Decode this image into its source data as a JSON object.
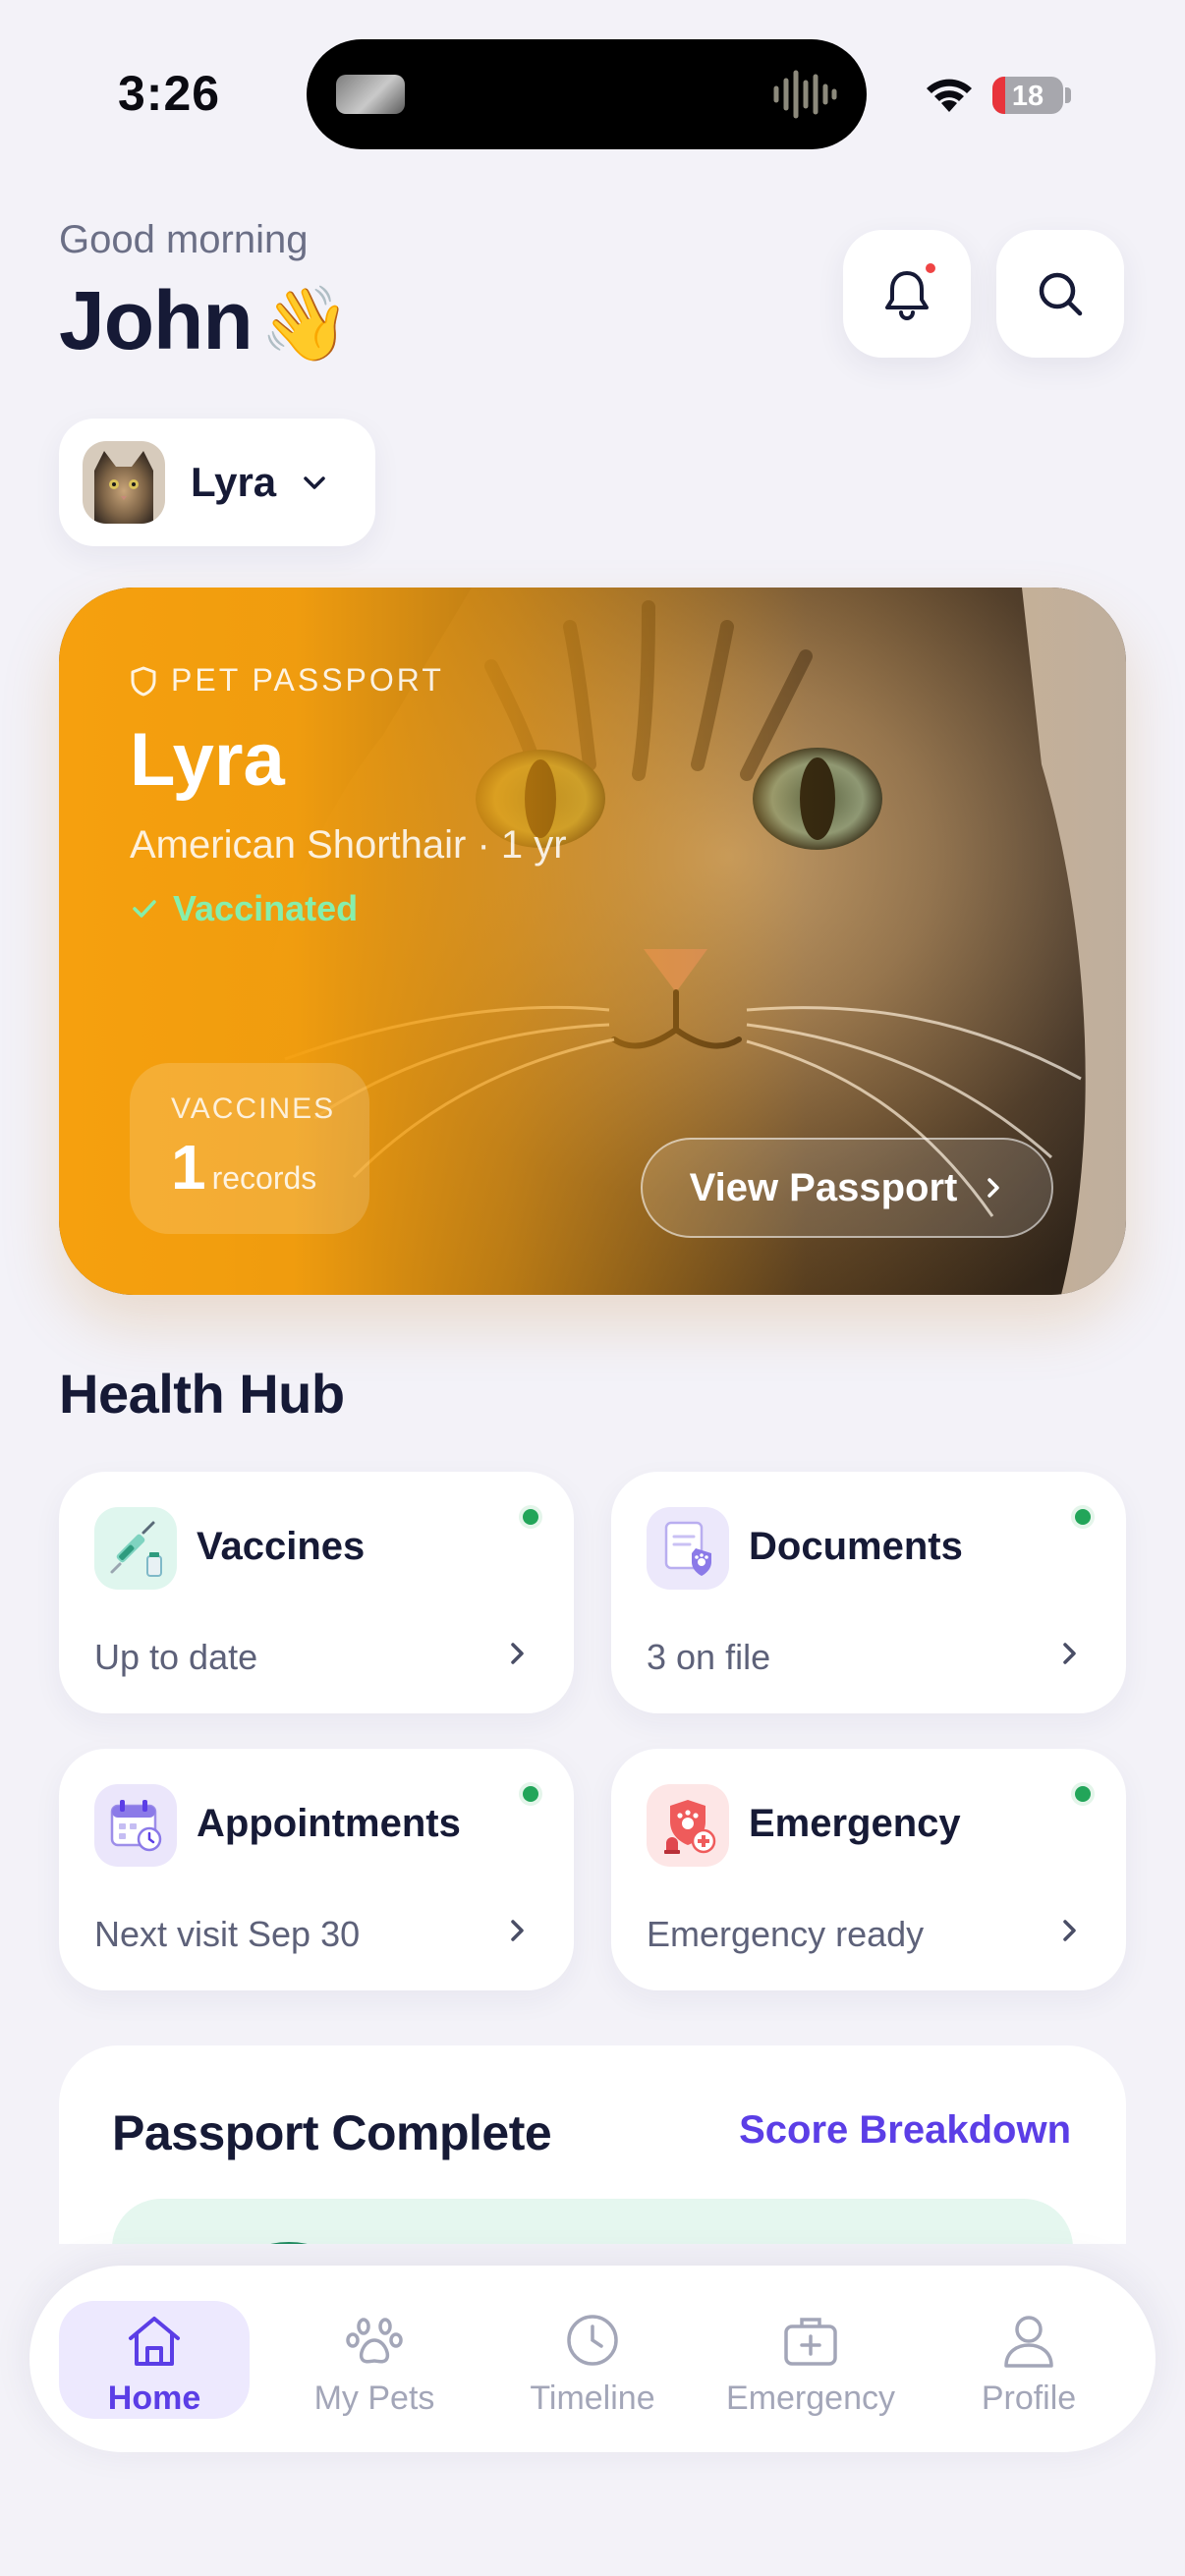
{
  "status_bar": {
    "time": "3:26",
    "battery_level": "18",
    "battery_fraction": 0.18,
    "icons": [
      "island-thumbnail-icon",
      "audio-wave-icon",
      "wifi-icon",
      "battery-icon"
    ]
  },
  "header": {
    "greeting": "Good morning",
    "user_name": "John",
    "emoji": "👋",
    "notification_icon": "bell-icon",
    "search_icon": "search-icon"
  },
  "pet_selector": {
    "name": "Lyra",
    "icon": "chevron-down-icon"
  },
  "passport_card": {
    "label": "PET PASSPORT",
    "pet_name": "Lyra",
    "breed_age": "American Shorthair · 1 yr",
    "status": "Vaccinated",
    "vaccines_label": "VACCINES",
    "vaccines_count": "1",
    "vaccines_unit": "records",
    "button_label": "View Passport",
    "colors": {
      "card": "#f6a00e",
      "status": "#86efac"
    }
  },
  "health_hub": {
    "title": "Health Hub",
    "items": [
      {
        "title": "Vaccines",
        "subtitle": "Up to date",
        "icon": "syringe-icon",
        "status_color": "#22a559"
      },
      {
        "title": "Documents",
        "subtitle": "3 on file",
        "icon": "document-paw-icon",
        "status_color": "#22a559"
      },
      {
        "title": "Appointments",
        "subtitle": "Next visit Sep 30",
        "icon": "calendar-icon",
        "status_color": "#22a559"
      },
      {
        "title": "Emergency",
        "subtitle": "Emergency ready",
        "icon": "emergency-shield-icon",
        "status_color": "#22a559"
      }
    ]
  },
  "passport_complete": {
    "title": "Passport Complete",
    "link": "Score Breakdown"
  },
  "bottom_nav": {
    "items": [
      {
        "label": "Home",
        "icon": "home-icon",
        "active": true
      },
      {
        "label": "My Pets",
        "icon": "paw-icon",
        "active": false
      },
      {
        "label": "Timeline",
        "icon": "clock-icon",
        "active": false
      },
      {
        "label": "Emergency",
        "icon": "medical-kit-icon",
        "active": false
      },
      {
        "label": "Profile",
        "icon": "profile-icon",
        "active": false
      }
    ],
    "accent": "#5b3ee6"
  }
}
